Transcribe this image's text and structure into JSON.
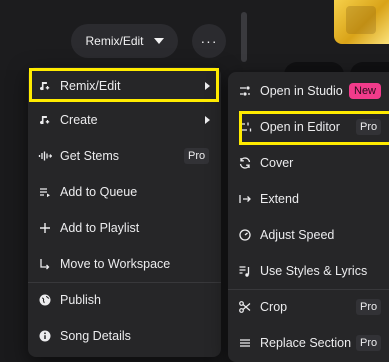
{
  "header": {
    "remix_button_label": "Remix/Edit",
    "more_button_label": "···"
  },
  "left_menu": {
    "items": [
      {
        "label": "Remix/Edit",
        "icon": "remix-icon",
        "submenu": true
      },
      {
        "label": "Create",
        "icon": "create-icon",
        "submenu": true
      },
      {
        "label": "Get Stems",
        "icon": "stems-icon",
        "badge": "Pro"
      },
      {
        "label": "Add to Queue",
        "icon": "queue-icon"
      },
      {
        "label": "Add to Playlist",
        "icon": "plus-icon"
      },
      {
        "label": "Move to Workspace",
        "icon": "move-icon"
      },
      {
        "label": "Publish",
        "icon": "globe-icon"
      },
      {
        "label": "Song Details",
        "icon": "info-icon"
      }
    ]
  },
  "right_menu": {
    "items": [
      {
        "label": "Open in Studio",
        "icon": "studio-icon",
        "badge": "New"
      },
      {
        "label": "Open in Editor",
        "icon": "editor-icon",
        "badge": "Pro"
      },
      {
        "label": "Cover",
        "icon": "cover-icon"
      },
      {
        "label": "Extend",
        "icon": "extend-icon"
      },
      {
        "label": "Adjust Speed",
        "icon": "speed-icon"
      },
      {
        "label": "Use Styles & Lyrics",
        "icon": "styles-lyrics-icon"
      },
      {
        "label": "Crop",
        "icon": "crop-icon",
        "badge": "Pro"
      },
      {
        "label": "Replace Section",
        "icon": "replace-icon",
        "badge": "Pro"
      }
    ]
  },
  "colors": {
    "highlight": "#ffeb00",
    "new_badge": "#f23b8b",
    "menu_bg": "#262628",
    "page_bg": "#1a1a1c"
  }
}
